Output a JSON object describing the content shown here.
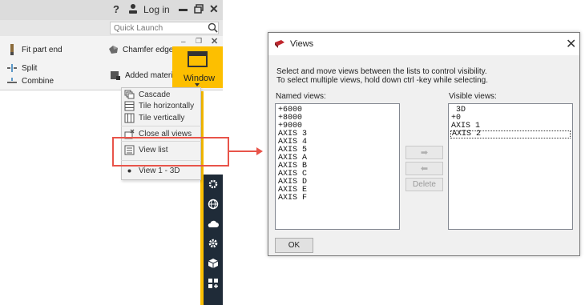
{
  "app": {
    "titlebar": {
      "help_glyph": "?",
      "login_label": "Log in",
      "close_glyph": "✕"
    },
    "quick_launch": {
      "placeholder": "Quick Launch"
    },
    "ribbon": {
      "fit_part_end": "Fit part end",
      "chamfer_edge": "Chamfer edge",
      "split": "Split",
      "combine": "Combine",
      "added_material": "Added materia",
      "window_button": "Window",
      "window_controls": {
        "min": "–",
        "restore": "❐",
        "close": "✕"
      }
    },
    "window_menu": {
      "items": [
        {
          "label": "Cascade",
          "icon": "cascade-icon"
        },
        {
          "label": "Tile horizontally",
          "icon": "tile-horizontal-icon"
        },
        {
          "label": "Tile vertically",
          "icon": "tile-vertical-icon"
        },
        {
          "label": "Close all views",
          "icon": "close-all-views-icon"
        },
        {
          "label": "View list",
          "icon": "view-list-icon"
        },
        {
          "label": "View 1 - 3D",
          "icon": "bullet-icon"
        }
      ]
    },
    "side_toolbar_icons": [
      "gear-settings-icon",
      "globe-icon",
      "cloud-icon",
      "settings-icon",
      "cube-icon",
      "apps-icon"
    ]
  },
  "dialog": {
    "title": "Views",
    "close_glyph": "✕",
    "instruction_line1": "Select and move views between the lists to control visibility.",
    "instruction_line2": "To select multiple views, hold down ctrl -key while selecting.",
    "named_views_label": "Named views:",
    "visible_views_label": "Visible views:",
    "named_views": [
      "+6000",
      "+8000",
      "+9000",
      "AXIS 3",
      "AXIS 4",
      "AXIS 5",
      "AXIS A",
      "AXIS B",
      "AXIS C",
      "AXIS D",
      "AXIS E",
      "AXIS F"
    ],
    "visible_views": [
      " 3D",
      "+0",
      "AXIS 1",
      "AXIS 2"
    ],
    "selected_visible": "AXIS 2",
    "move_right_glyph": "➡",
    "move_left_glyph": "⬅",
    "delete_label": "Delete",
    "ok_label": "OK"
  },
  "colors": {
    "accent_yellow": "#fdbf00",
    "highlight_red": "#e8544a",
    "side_toolbar": "#1f2b38"
  }
}
